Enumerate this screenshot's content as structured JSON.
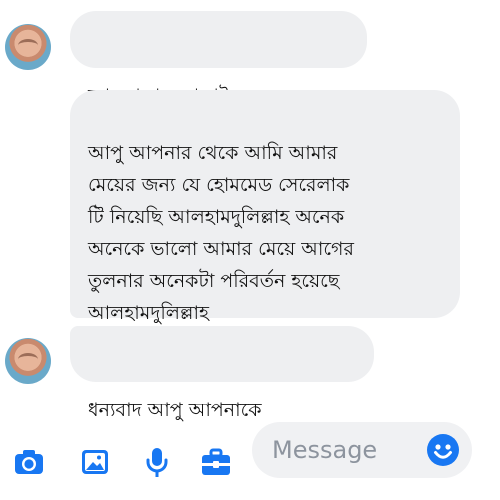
{
  "thread": {
    "messages": [
      {
        "text": "আসসালামু আলাইকুম"
      },
      {
        "text": "আপু আপনার থেকে আমি আমার\nমেয়ের জন্য যে হোমমেড সেরেলাক\nটি  নিয়েছি আলহামদুলিল্লাহ অনেক\nঅনেকে ভালো আমার মেয়ে আগের\nতুলনার অনেকটা পরিবর্তন হয়েছে\nআলহামদুলিল্লাহ"
      },
      {
        "text": "ধন্যবাদ আপু আপনাকে"
      }
    ]
  },
  "composer": {
    "placeholder": "Message",
    "icons": [
      "camera-icon",
      "photo-icon",
      "microphone-icon",
      "toolbox-icon",
      "emoji-icon"
    ],
    "accent_color": "#1877f2"
  }
}
